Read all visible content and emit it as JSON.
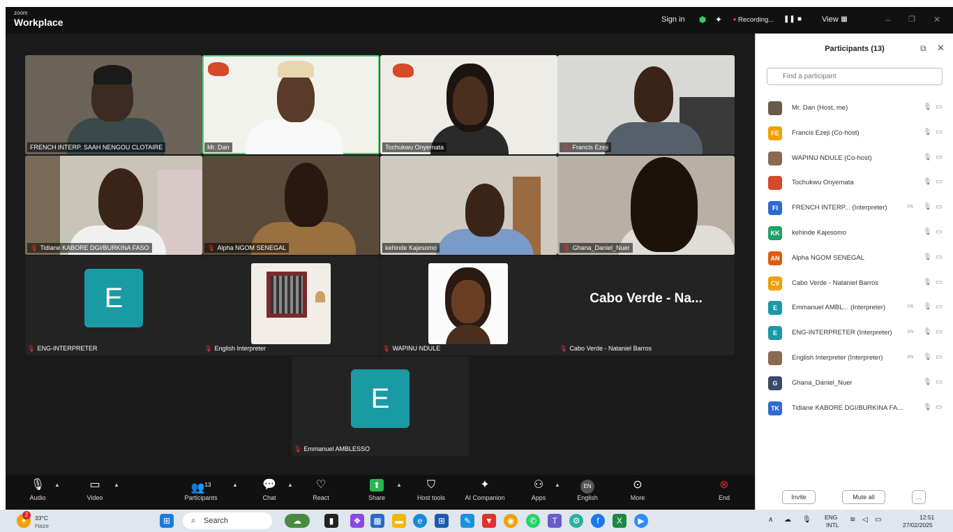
{
  "title_bar": {
    "brand_small": "zoom",
    "brand_large": "Workplace",
    "sign_in": "Sign in",
    "recording": "Recording...",
    "view": "View"
  },
  "video_tiles": [
    {
      "name": "FRENCH INTERP. SAAH NENGOU CLOTAIRE",
      "muted": false
    },
    {
      "name": "Mr. Dan",
      "muted": false
    },
    {
      "name": "Tochukwu Onyemata",
      "muted": false
    },
    {
      "name": "Francis Ezeji",
      "muted": true
    },
    {
      "name": "Tidiane KABORE DGI/BURKINA FASO",
      "muted": true
    },
    {
      "name": "Alpha NGOM SENEGAL",
      "muted": true
    },
    {
      "name": "kehinde Kajesomo",
      "muted": false
    },
    {
      "name": "Ghana_Daniel_Nuer",
      "muted": true
    }
  ],
  "audio_tiles": [
    {
      "name": "ENG-INTERPRETER",
      "avatar_letter": "E"
    },
    {
      "name": "English Interpreter"
    },
    {
      "name": "WAPINU NDULE"
    },
    {
      "name": "Cabo Verde - Nataniel Barros",
      "big_text": "Cabo Verde - Na..."
    },
    {
      "name": "Emmanuel AMBLESSO",
      "avatar_letter": "E"
    }
  ],
  "participants_panel": {
    "title": "Participants (13)",
    "search_placeholder": "Find a participant",
    "participants": [
      {
        "name": "Mr. Dan (Host, me)",
        "initials": "",
        "color": "#6a5a4a"
      },
      {
        "name": "Francis Ezeji (Co-host)",
        "initials": "FE",
        "color": "#f0a000"
      },
      {
        "name": "WAPINU NDULE (Co-host)",
        "initials": "",
        "color": "#8a6a50"
      },
      {
        "name": "Tochukwu Onyemata",
        "initials": "",
        "color": "#d44a2a"
      },
      {
        "name": "FRENCH INTERP... (Interpreter)",
        "initials": "FI",
        "color": "#2d6ad0",
        "tag": "FR"
      },
      {
        "name": "kehinde Kajesomo",
        "initials": "KK",
        "color": "#21a06a"
      },
      {
        "name": "Alpha NGOM SENEGAL",
        "initials": "AN",
        "color": "#e05a10"
      },
      {
        "name": "Cabo Verde - Nataniel Barros",
        "initials": "CV",
        "color": "#f0a000"
      },
      {
        "name": "Emmanuel AMBL... (Interpreter)",
        "initials": "E",
        "color": "#1a9aa5",
        "tag": "FR"
      },
      {
        "name": "ENG-INTERPRETER (Interpreter)",
        "initials": "E",
        "color": "#1a9aa5",
        "tag": "EN"
      },
      {
        "name": "English Interpreter (Interpreter)",
        "initials": "",
        "color": "#8a6a50",
        "tag": "EN"
      },
      {
        "name": "Ghana_Daniel_Nuer",
        "initials": "G",
        "color": "#3a4a6a"
      },
      {
        "name": "Tidiane KABORE DGI/BURKINA FA...",
        "initials": "TK",
        "color": "#2d6ad0"
      }
    ],
    "invite_label": "Invite",
    "mute_all_label": "Mute all",
    "more_label": "…"
  },
  "controls": {
    "audio": "Audio",
    "video": "Video",
    "participants": "Participants",
    "participants_count": "13",
    "chat": "Chat",
    "react": "React",
    "share": "Share",
    "host_tools": "Host tools",
    "ai_companion": "AI Companion",
    "apps": "Apps",
    "english": "English",
    "english_badge": "EN",
    "more": "More",
    "end": "End"
  },
  "taskbar": {
    "weather_temp": "33°C",
    "weather_desc": "Haze",
    "weather_badge": "2",
    "search": "Search",
    "lang_top": "ENG",
    "lang_bottom": "INTL",
    "time": "12:51",
    "date": "27/02/2025"
  },
  "colors": {
    "accent_teal": "#1a9aa5",
    "active_speaker_border": "#4ccf7a",
    "end_red": "#e0243a",
    "muted_red": "#e33333"
  }
}
